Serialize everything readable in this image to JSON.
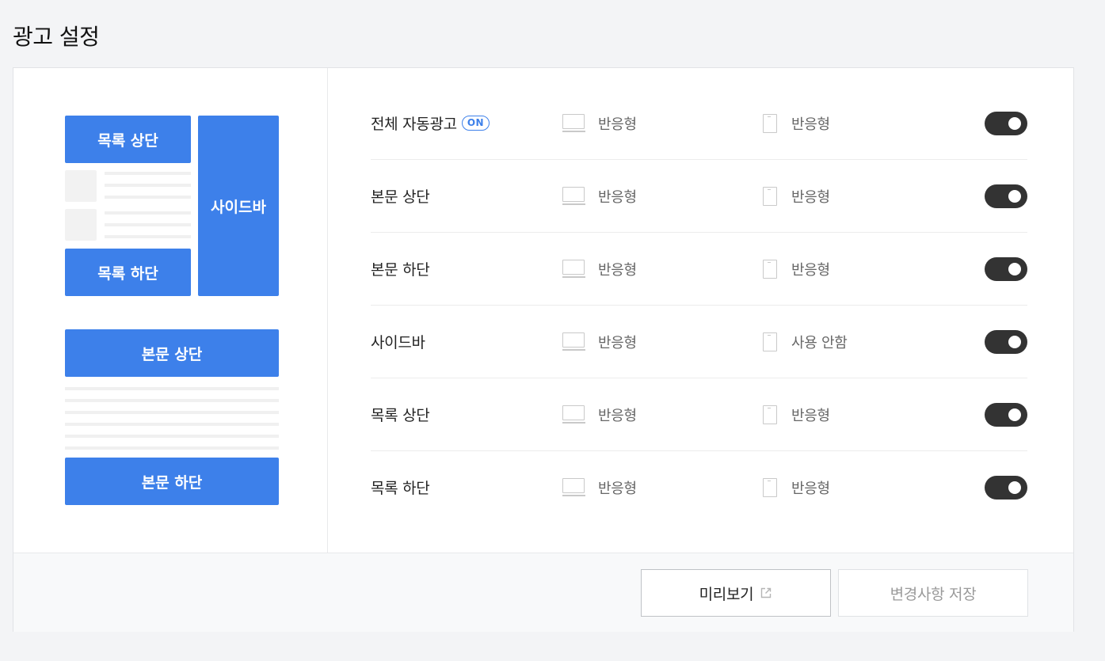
{
  "page": {
    "title": "광고 설정"
  },
  "preview": {
    "list_top": "목록 상단",
    "list_bottom": "목록 하단",
    "sidebar": "사이드바",
    "body_top": "본문 상단",
    "body_bottom": "본문 하단"
  },
  "settings": {
    "rows": [
      {
        "label": "전체 자동광고",
        "badge": "ON",
        "pc": "반응형",
        "mobile": "반응형",
        "enabled": true
      },
      {
        "label": "본문 상단",
        "pc": "반응형",
        "mobile": "반응형",
        "enabled": true
      },
      {
        "label": "본문 하단",
        "pc": "반응형",
        "mobile": "반응형",
        "enabled": true
      },
      {
        "label": "사이드바",
        "pc": "반응형",
        "mobile": "사용 안함",
        "enabled": true
      },
      {
        "label": "목록 상단",
        "pc": "반응형",
        "mobile": "반응형",
        "enabled": true
      },
      {
        "label": "목록 하단",
        "pc": "반응형",
        "mobile": "반응형",
        "enabled": true
      }
    ]
  },
  "footer": {
    "preview_label": "미리보기",
    "save_label": "변경사항 저장"
  },
  "icons": {
    "pc": "desktop-icon",
    "mobile": "mobile-icon",
    "external": "external-link-icon"
  },
  "colors": {
    "accent": "#3d80ea",
    "toggle_on": "#333333"
  }
}
